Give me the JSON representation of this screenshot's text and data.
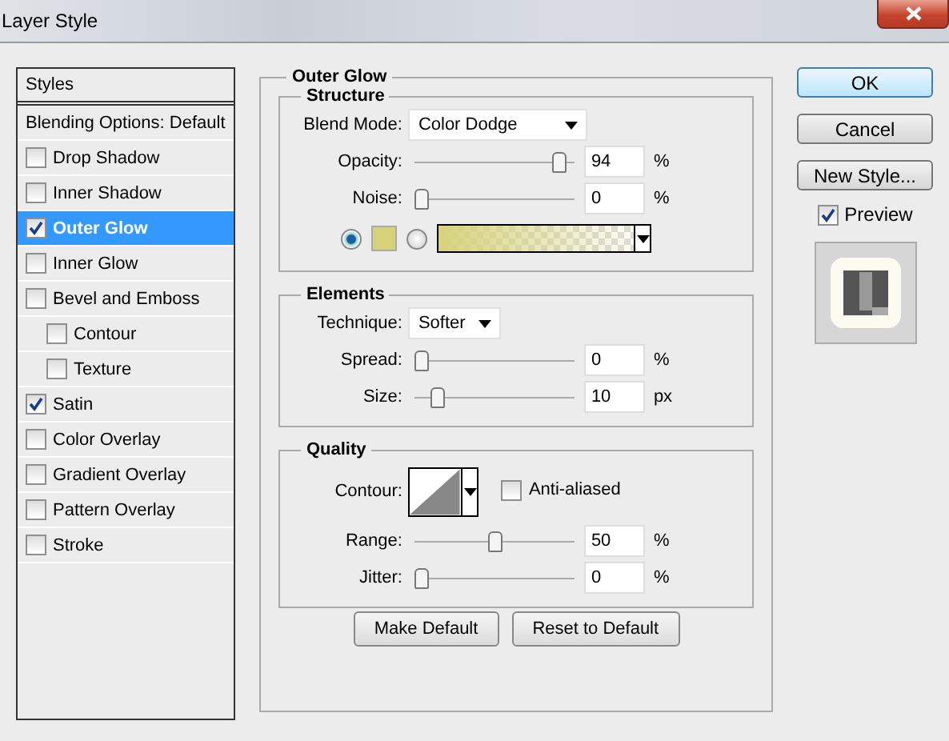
{
  "window": {
    "title": "Layer Style"
  },
  "styles_list": {
    "header": "Styles",
    "items": [
      {
        "kind": "plain",
        "label": "Blending Options: Default",
        "selected": false
      },
      {
        "kind": "check",
        "label": "Drop Shadow",
        "checked": false,
        "selected": false
      },
      {
        "kind": "check",
        "label": "Inner Shadow",
        "checked": false,
        "selected": false
      },
      {
        "kind": "check",
        "label": "Outer Glow",
        "checked": true,
        "selected": true
      },
      {
        "kind": "check",
        "label": "Inner Glow",
        "checked": false,
        "selected": false
      },
      {
        "kind": "check",
        "label": "Bevel and Emboss",
        "checked": false,
        "selected": false,
        "children": [
          {
            "kind": "check",
            "label": "Contour",
            "checked": false,
            "selected": false
          },
          {
            "kind": "check",
            "label": "Texture",
            "checked": false,
            "selected": false
          }
        ]
      },
      {
        "kind": "check",
        "label": "Satin",
        "checked": true,
        "selected": false
      },
      {
        "kind": "check",
        "label": "Color Overlay",
        "checked": false,
        "selected": false
      },
      {
        "kind": "check",
        "label": "Gradient Overlay",
        "checked": false,
        "selected": false
      },
      {
        "kind": "check",
        "label": "Pattern Overlay",
        "checked": false,
        "selected": false
      },
      {
        "kind": "check",
        "label": "Stroke",
        "checked": false,
        "selected": false
      }
    ]
  },
  "panel": {
    "title": "Outer Glow",
    "groups": [
      {
        "title": "Structure",
        "rows": [
          {
            "kind": "select",
            "label": "Blend Mode:",
            "value": "Color Dodge"
          },
          {
            "kind": "slider",
            "label": "Opacity:",
            "level": 0.94,
            "value": "94",
            "unit": "%"
          },
          {
            "kind": "slider",
            "label": "Noise:",
            "level": 0,
            "value": "0",
            "unit": "%"
          },
          {
            "kind": "fill",
            "options": [
              {
                "kind": "color",
                "selected": true,
                "color": "#d6d27c"
              },
              {
                "kind": "gradient",
                "selected": false,
                "color": "#d6d27c"
              }
            ]
          }
        ]
      },
      {
        "title": "Elements",
        "rows": [
          {
            "kind": "select",
            "label": "Technique:",
            "value": "Softer"
          },
          {
            "kind": "slider",
            "label": "Spread:",
            "level": 0,
            "value": "0",
            "unit": "%"
          },
          {
            "kind": "slider",
            "label": "Size:",
            "level": 0.1,
            "value": "10",
            "unit": "px"
          }
        ]
      },
      {
        "title": "Quality",
        "rows": [
          {
            "kind": "contour",
            "label": "Contour:",
            "option": {
              "label": "Anti-aliased",
              "checked": false
            }
          },
          {
            "kind": "slider",
            "label": "Range:",
            "level": 0.5,
            "value": "50",
            "unit": "%"
          },
          {
            "kind": "slider",
            "label": "Jitter:",
            "level": 0,
            "value": "0",
            "unit": "%"
          }
        ]
      }
    ],
    "buttons": [
      "Make Default",
      "Reset to Default"
    ]
  },
  "actions": [
    {
      "label": "OK",
      "default": true
    },
    {
      "label": "Cancel",
      "default": false
    },
    {
      "label": "New Style...",
      "default": false
    }
  ],
  "preview": {
    "label": "Preview",
    "checked": true
  }
}
